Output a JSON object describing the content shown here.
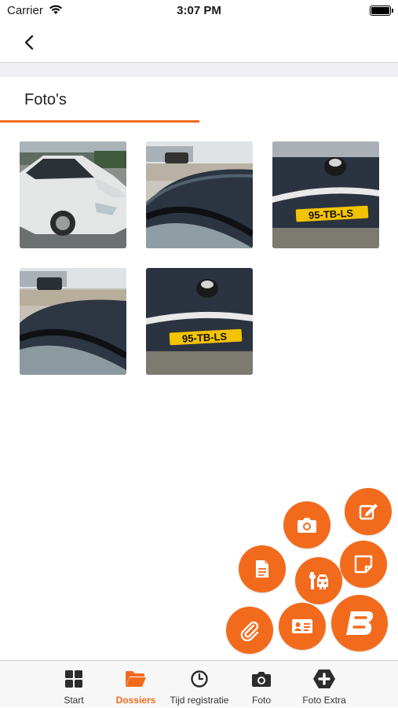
{
  "status_bar": {
    "carrier": "Carrier",
    "time": "3:07 PM"
  },
  "nav": {
    "back_icon": "chevron-left-icon"
  },
  "section": {
    "title": "Foto's"
  },
  "photos": [
    {
      "name": "white-car-front"
    },
    {
      "name": "car-roof-1"
    },
    {
      "name": "car-rear-plate-1",
      "plate": "95-TB-LS"
    },
    {
      "name": "car-roof-2"
    },
    {
      "name": "car-rear-plate-2",
      "plate": "95-TB-LS"
    }
  ],
  "fab": {
    "color": "#f26b1d",
    "items": [
      "edit-icon",
      "camera-icon",
      "document-icon",
      "vehicle-repair-icon",
      "note-icon",
      "attachment-icon",
      "contact-card-icon",
      "brand-logo-icon"
    ]
  },
  "tabbar": {
    "active_color": "#f26b1d",
    "items": [
      {
        "label": "Start",
        "icon": "grid-icon"
      },
      {
        "label": "Dossiers",
        "icon": "folder-icon"
      },
      {
        "label": "Tijd registratie",
        "icon": "clock-icon"
      },
      {
        "label": "Foto",
        "icon": "camera-icon"
      },
      {
        "label": "Foto Extra",
        "icon": "camera-plus-icon"
      }
    ]
  }
}
